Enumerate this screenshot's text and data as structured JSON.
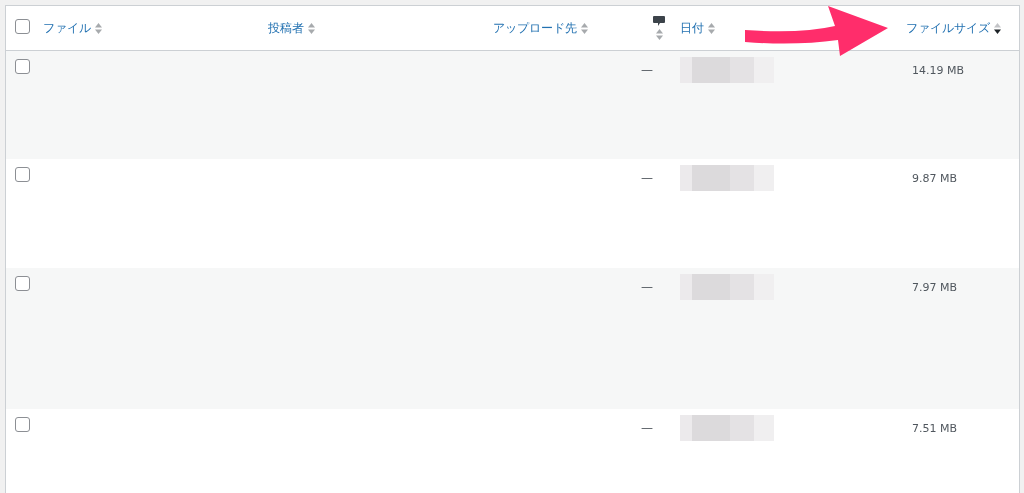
{
  "table": {
    "select_all": {
      "checked": false
    },
    "columns": [
      {
        "kind": "file",
        "label": "ファイル",
        "sorted": false
      },
      {
        "kind": "author",
        "label": "投稿者",
        "sorted": false
      },
      {
        "kind": "uploaded",
        "label": "アップロード先",
        "sorted": false
      },
      {
        "kind": "comments",
        "sorted": false
      },
      {
        "kind": "date",
        "label": "日付",
        "sorted": false
      },
      {
        "kind": "size",
        "label": "ファイルサイズ",
        "sorted": true
      }
    ],
    "rows": [
      {
        "checked": false,
        "comments": "—",
        "size": "14.19 MB"
      },
      {
        "checked": false,
        "comments": "—",
        "size": "9.87 MB"
      },
      {
        "checked": false,
        "comments": "—",
        "size": "7.97 MB"
      },
      {
        "checked": false,
        "comments": "—",
        "size": "7.51 MB"
      }
    ]
  }
}
